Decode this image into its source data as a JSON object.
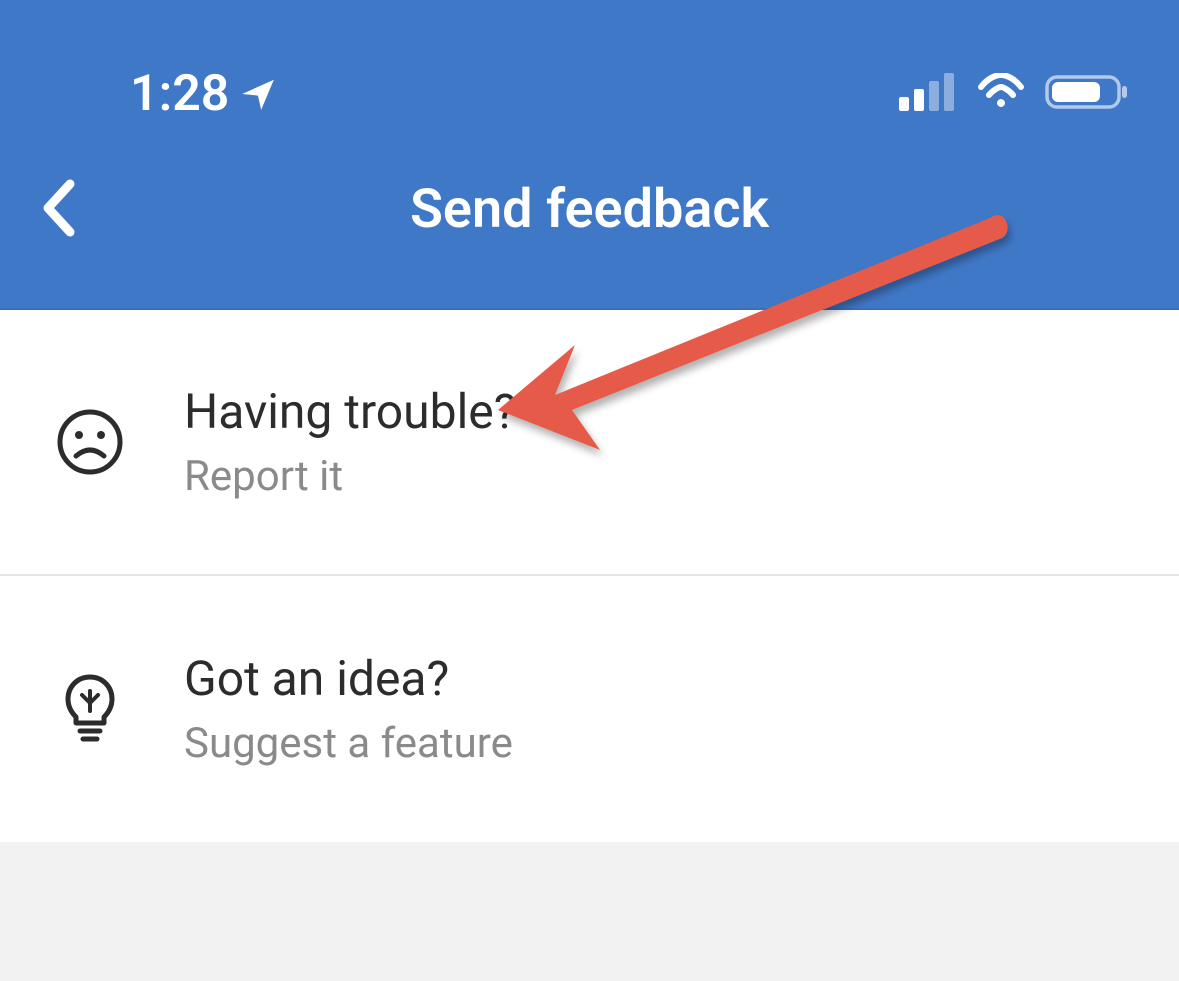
{
  "statusBar": {
    "time": "1:28"
  },
  "nav": {
    "title": "Send feedback"
  },
  "options": [
    {
      "title": "Having trouble?",
      "subtitle": "Report it"
    },
    {
      "title": "Got an idea?",
      "subtitle": "Suggest a feature"
    }
  ],
  "colors": {
    "headerBg": "#4078c8",
    "arrowColor": "#e55a4a"
  }
}
